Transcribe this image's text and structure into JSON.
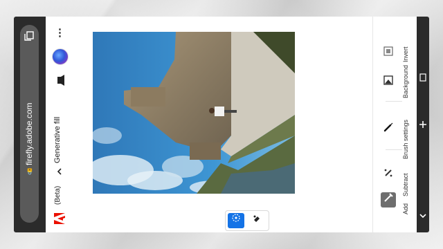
{
  "browser": {
    "url": "firefly.adobe.com",
    "tab_icon": "tab-switch-icon"
  },
  "header": {
    "brand_suffix": "(Beta)",
    "feature_title": "Generative fill",
    "menu_icon": "more-vertical-icon"
  },
  "canvas": {
    "image_description_icon": "photo"
  },
  "toggle": {
    "ai_icon": "generative-brush-icon",
    "erase_icon": "eraser-icon"
  },
  "tools": {
    "add_label": "Add",
    "subtract_label": "Subtract",
    "brush_settings_label": "Brush settings",
    "background_label": "Background",
    "invert_label": "Invert"
  },
  "colors": {
    "accent": "#1473e6",
    "adobe_red": "#eb1000",
    "browser_chrome": "#2b2b2b"
  }
}
